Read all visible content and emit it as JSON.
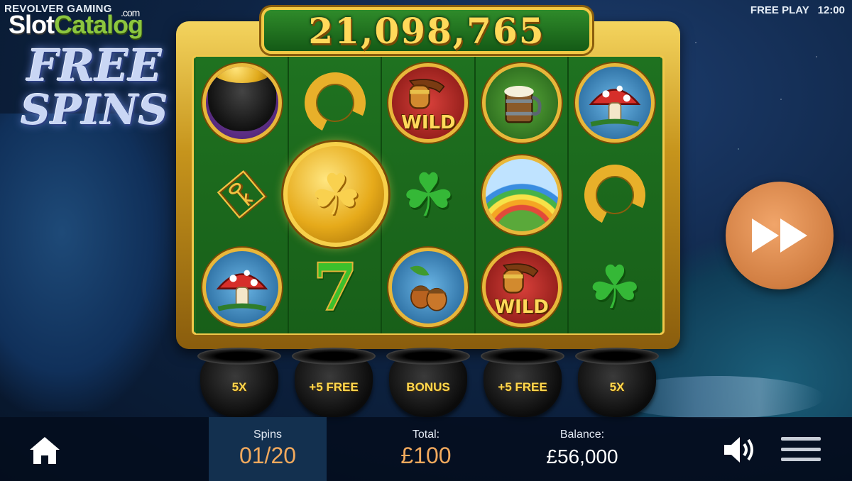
{
  "studio": "REVOLVER GAMING",
  "watermark": {
    "part1": "Slot",
    "part2": "Catalog",
    "suffix": ".com"
  },
  "header": {
    "mode": "FREE PLAY",
    "time": "12:00"
  },
  "title": {
    "line1": "FREE",
    "line2": "SPINS"
  },
  "win_amount": "21,098,765",
  "reels": [
    [
      {
        "symbol": "pot-of-gold"
      },
      {
        "symbol": "golden-key"
      },
      {
        "symbol": "mushroom"
      }
    ],
    [
      {
        "symbol": "horseshoe"
      },
      {
        "symbol": "gold-clover-coin"
      },
      {
        "symbol": "seven",
        "text": "7"
      }
    ],
    [
      {
        "symbol": "pipe",
        "label": "WILD"
      },
      {
        "symbol": "four-leaf-clover"
      },
      {
        "symbol": "acorns"
      }
    ],
    [
      {
        "symbol": "beer-mug"
      },
      {
        "symbol": "rainbow"
      },
      {
        "symbol": "pipe",
        "label": "WILD"
      }
    ],
    [
      {
        "symbol": "mushroom"
      },
      {
        "symbol": "horseshoe"
      },
      {
        "symbol": "four-leaf-clover"
      }
    ]
  ],
  "bonus_pots": [
    "5X",
    "+5 FREE",
    "BONUS",
    "+5 FREE",
    "5X"
  ],
  "footer": {
    "spins_label": "Spins",
    "spins_value": "01/20",
    "total_label": "Total:",
    "total_value": "£100",
    "balance_label": "Balance:",
    "balance_value": "£56,000"
  },
  "colors": {
    "accent": "#f1a95d",
    "gold": "#f2c944",
    "felt": "#1e6a1c",
    "button": "#d17e42"
  },
  "icons": [
    "home-icon",
    "sound-icon",
    "menu-icon",
    "fast-forward-icon"
  ]
}
